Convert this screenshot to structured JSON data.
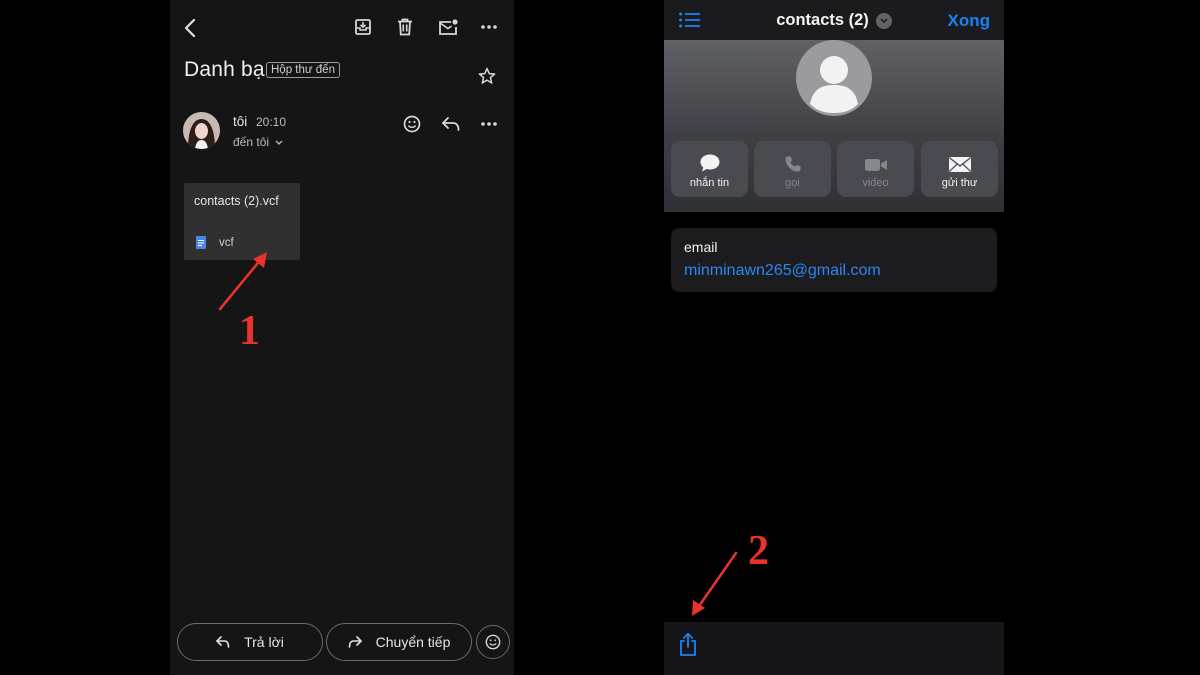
{
  "left": {
    "subject": "Danh bạ",
    "label": "Hộp thư đến",
    "sender": "tôi",
    "time": "20:10",
    "recipient": "đến tôi",
    "attachment": {
      "name": "contacts (2).vcf",
      "type": "vcf"
    },
    "reply_label": "Trả lời",
    "forward_label": "Chuyển tiếp",
    "icons": [
      "back-arrow-icon",
      "archive-icon",
      "trash-icon",
      "mark-unread-icon",
      "more-icon",
      "star-icon",
      "emoji-icon",
      "reply-icon"
    ]
  },
  "right": {
    "title": "contacts (2)",
    "done_label": "Xong",
    "actions": [
      {
        "label": "nhắn tin",
        "enabled": true
      },
      {
        "label": "gọi",
        "enabled": false
      },
      {
        "label": "video",
        "enabled": false
      },
      {
        "label": "gửi thư",
        "enabled": true
      }
    ],
    "email_label": "email",
    "email_value": "minminawn265@gmail.com",
    "icons": [
      "list-icon",
      "chevron-down-icon",
      "avatar-placeholder-icon",
      "share-icon"
    ]
  },
  "annotations": {
    "step1": "1",
    "step2": "2"
  },
  "colors": {
    "accent_blue": "#1a82f7",
    "annotation_red": "#e8322e",
    "link_blue": "#2b87f1"
  }
}
